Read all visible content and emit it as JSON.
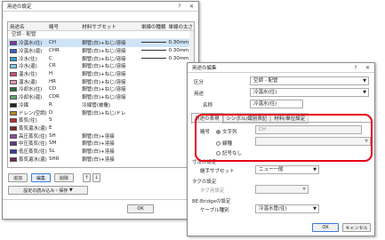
{
  "main": {
    "title": "用途の設定",
    "cols": [
      "用途名",
      "略号",
      "材料サブセット",
      "単線の種類",
      "単線の太さ"
    ],
    "group": "空調 - 配管",
    "rows": [
      {
        "name": "冷温水(往)",
        "code": "CH",
        "mat": "鋼管(白)+ねじ/溶接",
        "color": "#7b3aa8",
        "wt": "0.30mm"
      },
      {
        "name": "冷温水(還)",
        "code": "CHR",
        "mat": "鋼管(白)+ねじ/溶接",
        "color": "#3a5fbf",
        "wt": "0.30mm"
      },
      {
        "name": "冷水(往)",
        "code": "C",
        "mat": "鋼管(白)+ねじ/溶接",
        "color": "#2b9fd6",
        "wt": "0.30mm"
      },
      {
        "name": "冷水(還)",
        "code": "CR",
        "mat": "鋼管(白)+ねじ/溶接",
        "color": "#86cbe8",
        "wt": ""
      },
      {
        "name": "温水(往)",
        "code": "H",
        "mat": "鋼管(白)+ねじ/溶接",
        "color": "#d05070",
        "wt": ""
      },
      {
        "name": "温水(還)",
        "code": "HR",
        "mat": "鋼管(白)+ねじ/溶接",
        "color": "#e69bb0",
        "wt": ""
      },
      {
        "name": "冷却水(往)",
        "code": "CD",
        "mat": "鋼管(白)+ねじ/溶接",
        "color": "#2d6b3a",
        "wt": ""
      },
      {
        "name": "冷却水(還)",
        "code": "CDR",
        "mat": "鋼管(白)+ねじ/溶接",
        "color": "#5fa86c",
        "wt": ""
      },
      {
        "name": "冷媒",
        "code": "R",
        "mat": "冷媒管(被覆)",
        "color": "#222",
        "wt": ""
      },
      {
        "name": "ドレン(空調)",
        "code": "D",
        "mat": "鋼管(白)+ねじ/ドレ",
        "color": "#b48a2a",
        "wt": ""
      },
      {
        "name": "蒸気(往)",
        "code": "S",
        "mat": "",
        "color": "#b53030",
        "wt": ""
      },
      {
        "name": "蒸気還水(還)",
        "code": "E",
        "mat": "",
        "color": "#7b2a2a",
        "wt": ""
      },
      {
        "name": "高圧蒸気(往)",
        "code": "SH",
        "mat": "鋼管(白)+溶接",
        "color": "#8a4f9e",
        "wt": ""
      },
      {
        "name": "中圧蒸気(往)",
        "code": "SM",
        "mat": "鋼管(白)+溶接",
        "color": "#5f3a86",
        "wt": ""
      },
      {
        "name": "低圧蒸気(往)",
        "code": "SL",
        "mat": "鋼管(白)+溶接",
        "color": "#3c3c9a",
        "wt": ""
      },
      {
        "name": "蒸気還水(還)",
        "code": "SHR",
        "mat": "鋼管(白)+溶接",
        "color": "#6b2a5a",
        "wt": ""
      }
    ],
    "add": "追加",
    "edit": "編集",
    "del": "削除",
    "load": "設定の読み込み・保存",
    "ok": "OK"
  },
  "edit": {
    "title": "用途の編集",
    "kubun_l": "区分",
    "kubun_v": "空調 - 配管",
    "youto_l": "用途",
    "youto_v": "冷温水(往)",
    "name_l": "名称",
    "name_v": "冷温水(往)",
    "tabs": [
      "用途の表現",
      "シンボル/識別表記",
      "材料/単位設定"
    ],
    "ryaku_l": "略号",
    "r1": "文字列",
    "r1v": "CH",
    "r2": "線種",
    "r3": "記号なし",
    "sub1": "寸法の設定",
    "sub1_l": "継手サブセット",
    "sub1_v": "ニュー一般",
    "sub2": "タグの設定",
    "sub2_l": "タグ用設定",
    "sub3": "BE-Bridgeの設定",
    "sub3_l": "ケーブル種別",
    "sub3_v": "冷温水管(往)",
    "ok": "OK",
    "cancel": "キャンセル"
  }
}
